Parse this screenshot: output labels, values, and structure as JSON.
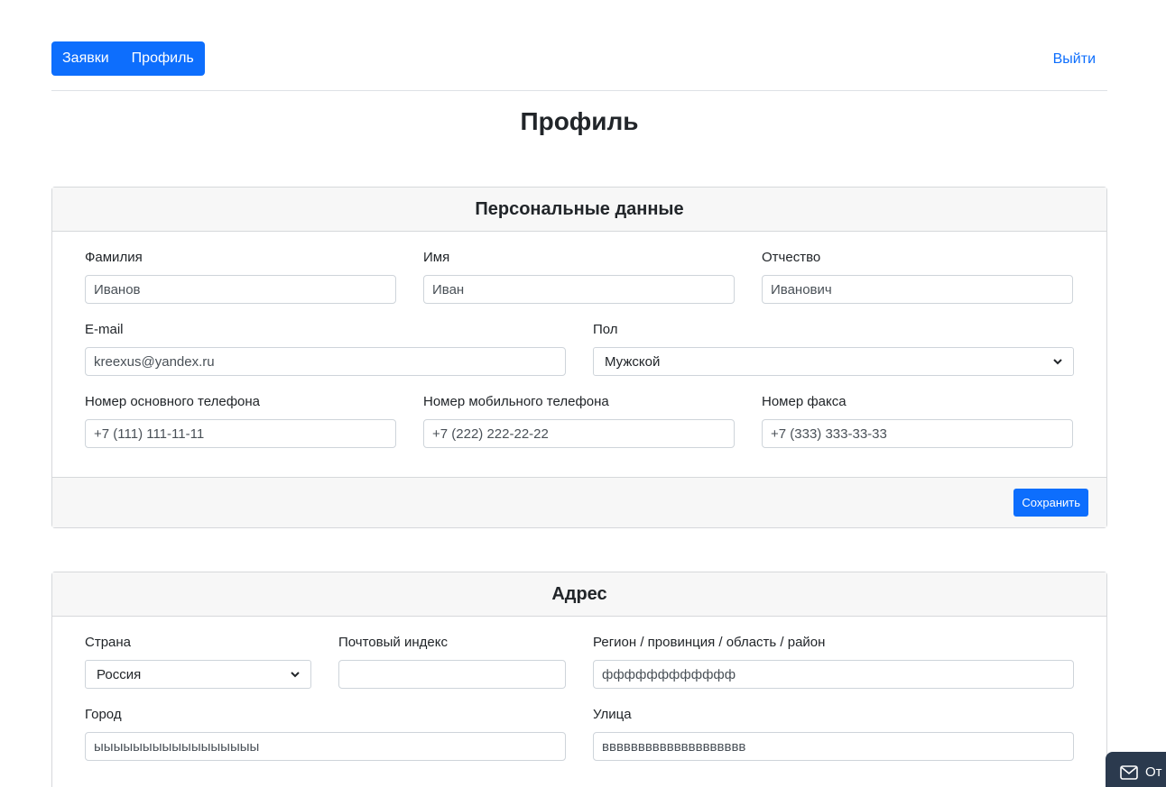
{
  "nav": {
    "items": [
      {
        "label": "Заявки"
      },
      {
        "label": "Профиль"
      }
    ],
    "logout_label": "Выйти",
    "accent": "#0d6efd"
  },
  "page": {
    "title": "Профиль"
  },
  "personal": {
    "header": "Персональные данные",
    "fields": {
      "last_name": {
        "label": "Фамилия",
        "value": "Иванов"
      },
      "first_name": {
        "label": "Имя",
        "value": "Иван"
      },
      "patronymic": {
        "label": "Отчество",
        "value": "Иванович"
      },
      "email": {
        "label": "E-mail",
        "value": "kreexus@yandex.ru"
      },
      "gender": {
        "label": "Пол",
        "value": "Мужской"
      },
      "phone_main": {
        "label": "Номер основного телефона",
        "value": "+7 (111) 111-11-11"
      },
      "phone_mobile": {
        "label": "Номер мобильного телефона",
        "value": "+7 (222) 222-22-22"
      },
      "fax": {
        "label": "Номер факса",
        "value": "+7 (333) 333-33-33"
      }
    },
    "save_label": "Сохранить"
  },
  "address": {
    "header": "Адрес",
    "fields": {
      "country": {
        "label": "Страна",
        "value": "Россия"
      },
      "postal": {
        "label": "Почтовый индекс",
        "value": ""
      },
      "region": {
        "label": "Регион / провинция / область / район",
        "value": "фффффффффффф"
      },
      "city": {
        "label": "Город",
        "value": "ыыыыыыыыыыыыыыыыы"
      },
      "street": {
        "label": "Улица",
        "value": "вввввввввввввввввввв"
      }
    }
  },
  "feedback": {
    "label": "От",
    "icon": "mail-icon"
  }
}
